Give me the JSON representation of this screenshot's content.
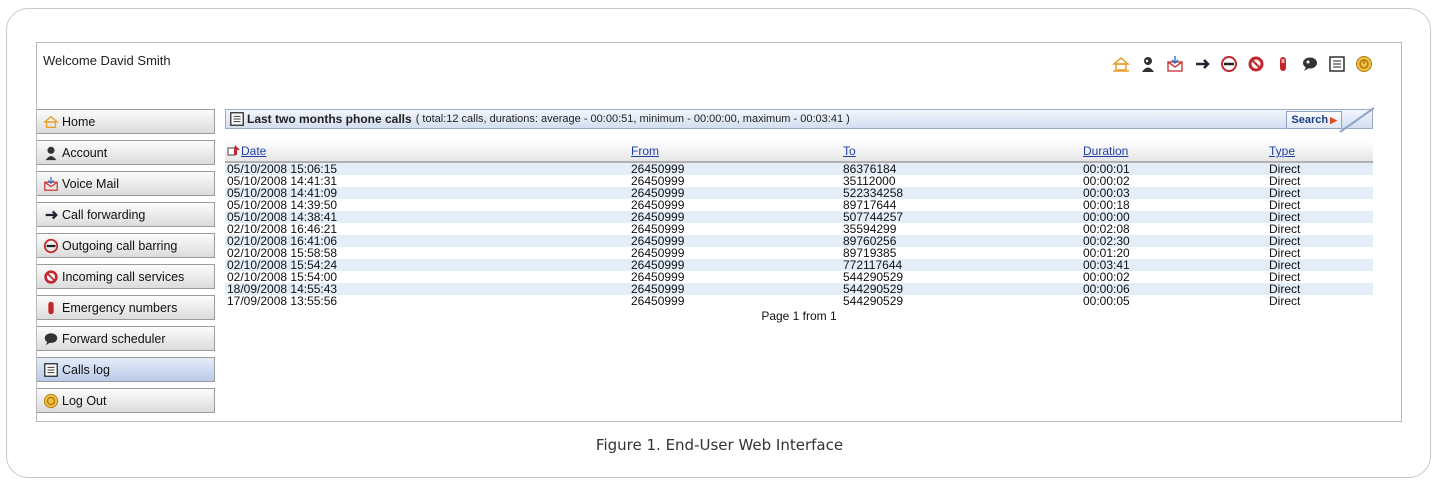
{
  "welcome": "Welcome David Smith",
  "top_icons": [
    "home-icon",
    "account-icon",
    "voicemail-icon",
    "call-forwarding-icon",
    "outgoing-barring-icon",
    "incoming-services-icon",
    "emergency-icon",
    "scheduler-icon",
    "calls-log-icon",
    "logout-icon"
  ],
  "sidebar": {
    "items": [
      {
        "label": "Home",
        "icon": "home-icon"
      },
      {
        "label": "Account",
        "icon": "account-icon"
      },
      {
        "label": "Voice Mail",
        "icon": "voicemail-icon"
      },
      {
        "label": "Call forwarding",
        "icon": "call-forwarding-icon"
      },
      {
        "label": "Outgoing call barring",
        "icon": "outgoing-barring-icon"
      },
      {
        "label": "Incoming call services",
        "icon": "incoming-services-icon"
      },
      {
        "label": "Emergency numbers",
        "icon": "emergency-icon"
      },
      {
        "label": "Forward scheduler",
        "icon": "scheduler-icon"
      },
      {
        "label": "Calls log",
        "icon": "calls-log-icon",
        "active": true
      },
      {
        "label": "Log Out",
        "icon": "logout-icon"
      }
    ]
  },
  "calls": {
    "title": "Last two months phone calls",
    "summary": "( total:12 calls, durations: average - 00:00:51, minimum - 00:00:00, maximum - 00:03:41 )",
    "search_label": "Search",
    "columns": {
      "date": "Date",
      "from": "From",
      "to": "To",
      "duration": "Duration",
      "type": "Type"
    },
    "rows": [
      [
        "05/10/2008 15:06:15",
        "26450999",
        "86376184",
        "00:00:01",
        "Direct"
      ],
      [
        "05/10/2008 14:41:31",
        "26450999",
        "35112000",
        "00:00:02",
        "Direct"
      ],
      [
        "05/10/2008 14:41:09",
        "26450999",
        "522334258",
        "00:00:03",
        "Direct"
      ],
      [
        "05/10/2008 14:39:50",
        "26450999",
        "89717644",
        "00:00:18",
        "Direct"
      ],
      [
        "05/10/2008 14:38:41",
        "26450999",
        "507744257",
        "00:00:00",
        "Direct"
      ],
      [
        "02/10/2008 16:46:21",
        "26450999",
        "35594299",
        "00:02:08",
        "Direct"
      ],
      [
        "02/10/2008 16:41:06",
        "26450999",
        "89760256",
        "00:02:30",
        "Direct"
      ],
      [
        "02/10/2008 15:58:58",
        "26450999",
        "89719385",
        "00:01:20",
        "Direct"
      ],
      [
        "02/10/2008 15:54:24",
        "26450999",
        "772117644",
        "00:03:41",
        "Direct"
      ],
      [
        "02/10/2008 15:54:00",
        "26450999",
        "544290529",
        "00:00:02",
        "Direct"
      ],
      [
        "18/09/2008 14:55:43",
        "26450999",
        "544290529",
        "00:00:06",
        "Direct"
      ],
      [
        "17/09/2008 13:55:56",
        "26450999",
        "544290529",
        "00:00:05",
        "Direct"
      ]
    ],
    "pager": "Page 1 from 1"
  },
  "caption": "Figure 1.  End-User Web Interface"
}
